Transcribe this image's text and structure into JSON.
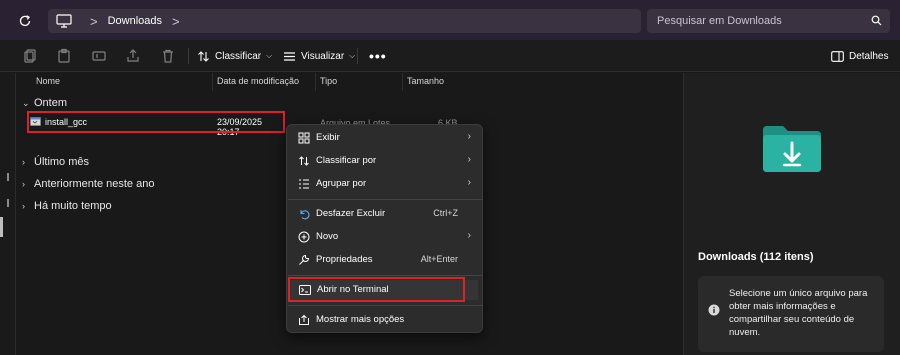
{
  "address": {
    "breadcrumb": "Downloads",
    "separator": ">"
  },
  "search": {
    "placeholder": "Pesquisar em Downloads"
  },
  "toolbar": {
    "sort_label": "Classificar",
    "view_label": "Visualizar",
    "more_label": "•••",
    "details_label": "Detalhes"
  },
  "columns": [
    "Nome",
    "Data de modificação",
    "Tipo",
    "Tamanho"
  ],
  "groups": {
    "today": "Ontem",
    "last_month": "Último mês",
    "earlier_year": "Anteriormente neste ano",
    "long_ago": "Há muito tempo"
  },
  "file": {
    "name": "install_gcc",
    "modified": "23/09/2025 20:17",
    "type_partial": "Arquivo em Lotes",
    "size_partial": "6 KB"
  },
  "context_menu": {
    "items": [
      {
        "label": "Exibir",
        "icon": "grid-icon",
        "submenu": true
      },
      {
        "label": "Classificar por",
        "icon": "sort-icon",
        "submenu": true
      },
      {
        "label": "Agrupar por",
        "icon": "group-list-icon",
        "submenu": true
      },
      {
        "label": "Desfazer Excluir",
        "icon": "undo-icon",
        "shortcut": "Ctrl+Z"
      },
      {
        "label": "Novo",
        "icon": "plus-circle-icon",
        "submenu": true
      },
      {
        "label": "Propriedades",
        "icon": "wrench-icon",
        "shortcut": "Alt+Enter"
      },
      {
        "label": "Abrir no Terminal",
        "icon": "terminal-icon"
      },
      {
        "label": "Mostrar mais opções",
        "icon": "share-more-icon"
      }
    ]
  },
  "details": {
    "title": "Downloads (112 itens)",
    "info_text": "Selecione um único arquivo para obter mais informações e compartilhar seu conteúdo de nuvem."
  },
  "colors": {
    "accent_folder": "#2ab3a3",
    "highlight_red": "#d8232a",
    "titlebar": "#2a2233",
    "background": "#191919"
  }
}
